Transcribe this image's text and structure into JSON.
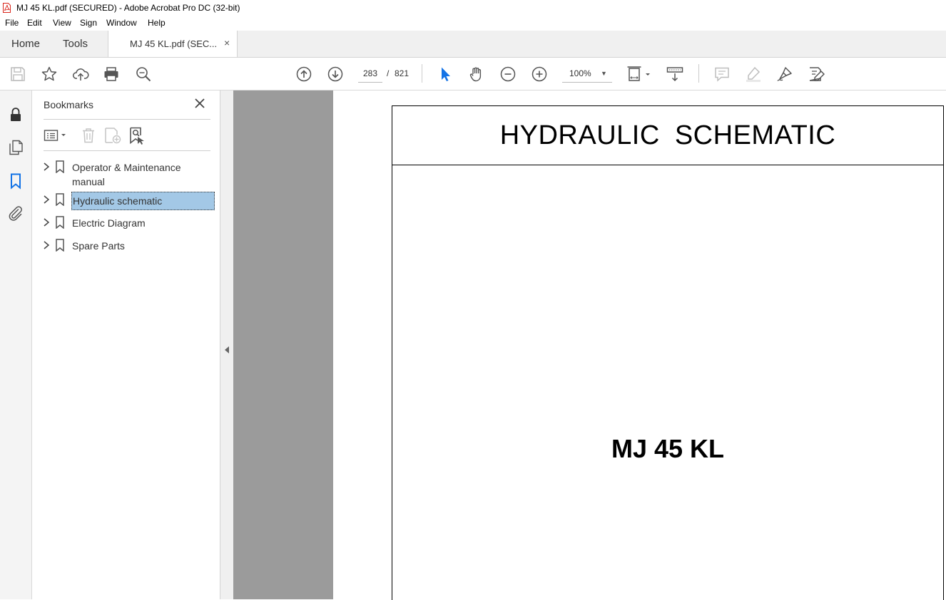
{
  "window": {
    "title": "MJ 45 KL.pdf (SECURED) - Adobe Acrobat Pro DC (32-bit)"
  },
  "menu": [
    "File",
    "Edit",
    "View",
    "Sign",
    "Window",
    "Help"
  ],
  "tabs": {
    "home": "Home",
    "tools": "Tools",
    "document": "MJ 45 KL.pdf (SEC...",
    "close": "×"
  },
  "toolbar": {
    "page_current": "283",
    "page_separator": "/",
    "page_total": "821",
    "zoom": "100%"
  },
  "bookmarks": {
    "title": "Bookmarks",
    "items": [
      {
        "label": "Operator & Maintenance manual",
        "line1": "Operator & Maintenance",
        "line2": "manual",
        "selected": false
      },
      {
        "label": "Hydraulic schematic",
        "selected": true
      },
      {
        "label": "Electric Diagram",
        "selected": false
      },
      {
        "label": "Spare Parts",
        "selected": false
      }
    ]
  },
  "document": {
    "heading": "HYDRAULIC  SCHEMATIC",
    "model": "MJ 45 KL"
  },
  "colors": {
    "selection": "#a3c8e6",
    "accent_blue": "#1473e6",
    "gray_strip": "#9b9b9b",
    "pdf_red": "#d9261c"
  }
}
